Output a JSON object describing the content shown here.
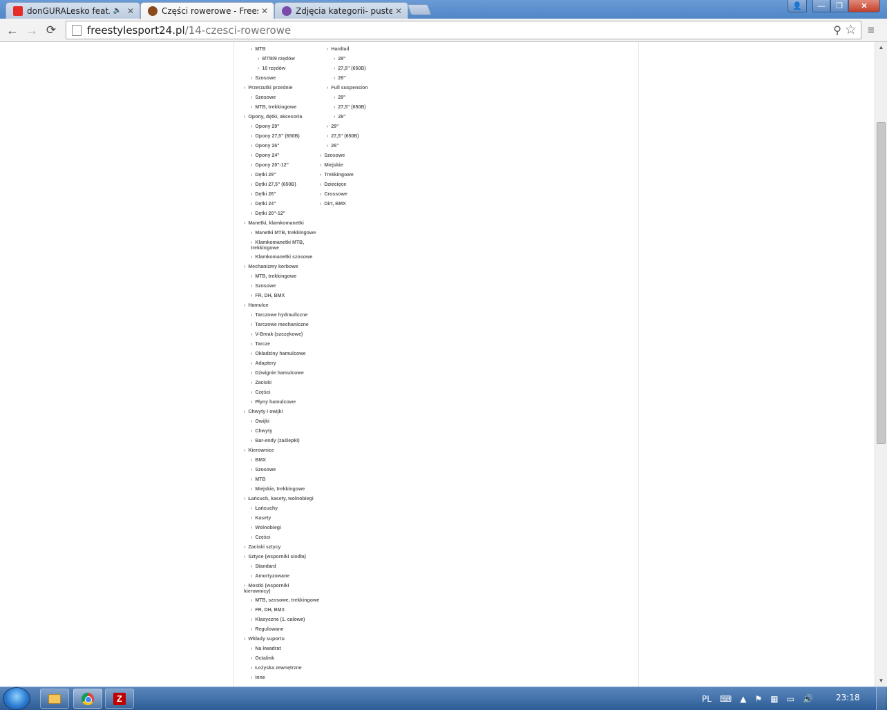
{
  "tabs": [
    {
      "title": "donGURALesko feat. D",
      "favicon_color": "#e52d27",
      "audio": true,
      "close_label": "✕"
    },
    {
      "title": "Części rowerowe - Freesty",
      "favicon_color": "#8a4a1c",
      "audio": false,
      "close_label": "✕"
    },
    {
      "title": "Zdjęcia kategorii- puste m",
      "favicon_color": "#7a4aa8",
      "audio": false,
      "close_label": "✕"
    }
  ],
  "window_controls": {
    "user": "👤",
    "minimize": "—",
    "maximize": "❐",
    "close": "✕"
  },
  "toolbar": {
    "back": "←",
    "forward": "→",
    "reload": "⟳",
    "url_host": "freestylesport24.pl",
    "url_path": "/14-czesci-rowerowe",
    "zoom_icon": "⚲",
    "star_icon": "☆",
    "menu_icon": "≡"
  },
  "arrow": "›",
  "left_column": [
    {
      "label": "MTB",
      "indent": 1
    },
    {
      "label": "8/7/8/9 rzędów",
      "indent": 2
    },
    {
      "label": "10 rzędów",
      "indent": 2
    },
    {
      "label": "Szosowe",
      "indent": 1
    },
    {
      "label": "Przerzutki przednie",
      "indent": 0
    },
    {
      "label": "Szosowe",
      "indent": 1
    },
    {
      "label": "MTB, trekkingowe",
      "indent": 1
    },
    {
      "label": "Opony, dętki, akcesoria",
      "indent": 0
    },
    {
      "label": "Opony 29\"",
      "indent": 1
    },
    {
      "label": "Opony 27,5\" (650B)",
      "indent": 1
    },
    {
      "label": "Opony 26\"",
      "indent": 1
    },
    {
      "label": "Opony 24\"",
      "indent": 1
    },
    {
      "label": "Opony 20\"-12\"",
      "indent": 1
    },
    {
      "label": "Dętki 29\"",
      "indent": 1
    },
    {
      "label": "Dętki 27,5\" (650B)",
      "indent": 1
    },
    {
      "label": "Dętki 26\"",
      "indent": 1
    },
    {
      "label": "Dętki 24\"",
      "indent": 1
    },
    {
      "label": "Dętki 20\"-12\"",
      "indent": 1
    },
    {
      "label": "Manetki, klamkomanetki",
      "indent": 0
    },
    {
      "label": "Manetki MTB, trekkingowe",
      "indent": 1
    },
    {
      "label": "Klamkomanetki MTB, trekkingowe",
      "indent": 1,
      "wrap": true
    },
    {
      "label": "Klamkomanetki szosowe",
      "indent": 1
    },
    {
      "label": "Mechanizmy korbowe",
      "indent": 0
    },
    {
      "label": "MTB, trekkingowe",
      "indent": 1
    },
    {
      "label": "Szosowe",
      "indent": 1
    },
    {
      "label": "FR, DH, BMX",
      "indent": 1
    },
    {
      "label": "Hamulce",
      "indent": 0
    },
    {
      "label": "Tarczowe hydrauliczne",
      "indent": 1
    },
    {
      "label": "Tarczowe mechaniczne",
      "indent": 1
    },
    {
      "label": "V-Break (szczękowe)",
      "indent": 1
    },
    {
      "label": "Tarcze",
      "indent": 1
    },
    {
      "label": "Okładziny hamulcowe",
      "indent": 1
    },
    {
      "label": "Adaptery",
      "indent": 1
    },
    {
      "label": "Dźwignie hamulcowe",
      "indent": 1
    },
    {
      "label": "Zaciski",
      "indent": 1
    },
    {
      "label": "Części",
      "indent": 1
    },
    {
      "label": "Płyny hamulcowe",
      "indent": 1
    },
    {
      "label": "Chwyty i owijki",
      "indent": 0
    },
    {
      "label": "Owijki",
      "indent": 1
    },
    {
      "label": "Chwyty",
      "indent": 1
    },
    {
      "label": "Bar-endy (zaślepki)",
      "indent": 1
    },
    {
      "label": "Kierownice",
      "indent": 0
    },
    {
      "label": "BMX",
      "indent": 1
    },
    {
      "label": "Szosowe",
      "indent": 1
    },
    {
      "label": "MTB",
      "indent": 1
    },
    {
      "label": "Miejskie, trekkingowe",
      "indent": 1
    },
    {
      "label": "Łańcuch, kasety, wolnobiegi",
      "indent": 0
    },
    {
      "label": "Łańcuchy",
      "indent": 1
    },
    {
      "label": "Kasety",
      "indent": 1
    },
    {
      "label": "Wolnobiegi",
      "indent": 1
    },
    {
      "label": "Części",
      "indent": 1
    },
    {
      "label": "Zaciski sztycy",
      "indent": 0
    },
    {
      "label": "Sztyce (wsporniki siodła)",
      "indent": 0
    },
    {
      "label": "Standard",
      "indent": 1
    },
    {
      "label": "Amortyzowane",
      "indent": 1
    },
    {
      "label": "Mostki (wsporniki kierownicy)",
      "indent": 0,
      "wrap": true
    },
    {
      "label": "MTB, szosowe, trekkingowe",
      "indent": 1
    },
    {
      "label": "FR, DH, BMX",
      "indent": 1
    },
    {
      "label": "Klasyczne (1. calowe)",
      "indent": 1
    },
    {
      "label": "Regulowane",
      "indent": 1
    },
    {
      "label": "Wkłady suportu",
      "indent": 0
    },
    {
      "label": "Na kwadrat",
      "indent": 1
    },
    {
      "label": "Octalink",
      "indent": 1
    },
    {
      "label": "Łożyska zewnętrzne",
      "indent": 1
    },
    {
      "label": "Inne",
      "indent": 1
    }
  ],
  "right_column": [
    {
      "label": "Hardtail",
      "indent": 1
    },
    {
      "label": "29\"",
      "indent": 2
    },
    {
      "label": "27,5\" (650B)",
      "indent": 2
    },
    {
      "label": "26\"",
      "indent": 2
    },
    {
      "label": "Full suspension",
      "indent": 1
    },
    {
      "label": "29\"",
      "indent": 2
    },
    {
      "label": "27,5\" (650B)",
      "indent": 2
    },
    {
      "label": "26\"",
      "indent": 2
    },
    {
      "label": "29\"",
      "indent": 1
    },
    {
      "label": "27,5\" (650B)",
      "indent": 1
    },
    {
      "label": "26\"",
      "indent": 1
    },
    {
      "label": "Szosowe",
      "indent": 0
    },
    {
      "label": "Miejskie",
      "indent": 0
    },
    {
      "label": "Trekkingowe",
      "indent": 0
    },
    {
      "label": "Dziecięce",
      "indent": 0
    },
    {
      "label": "Crossowe",
      "indent": 0
    },
    {
      "label": "Dirt, BMX",
      "indent": 0
    }
  ],
  "scrollbar": {
    "up": "▲",
    "down": "▼",
    "position": 0.12
  },
  "taskbar": {
    "language": "PL",
    "clock": "23:18",
    "tray_icons": [
      "keyboard-icon",
      "show-hidden-icon",
      "flag-icon",
      "network-icon",
      "monitor-icon",
      "speaker-icon"
    ]
  }
}
